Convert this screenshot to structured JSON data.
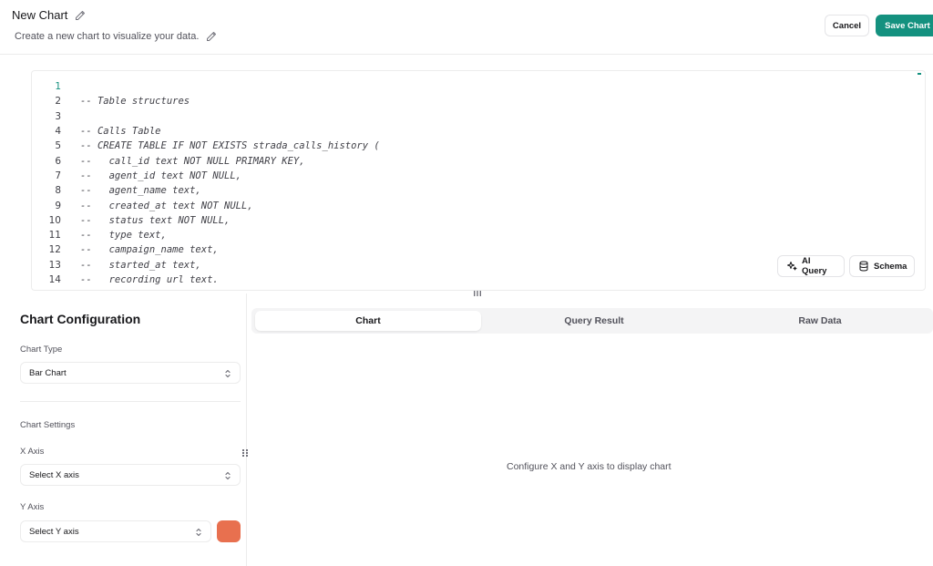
{
  "header": {
    "title": "New Chart",
    "description": "Create a new chart to visualize your data.",
    "cancel_label": "Cancel",
    "save_label": "Save Chart"
  },
  "editor": {
    "active_line": 1,
    "lines": [
      {
        "num": "1",
        "code": ""
      },
      {
        "num": "2",
        "code": "-- Table structures"
      },
      {
        "num": "3",
        "code": ""
      },
      {
        "num": "4",
        "code": "-- Calls Table"
      },
      {
        "num": "5",
        "code": "-- CREATE TABLE IF NOT EXISTS strada_calls_history ("
      },
      {
        "num": "6",
        "code": "--   call_id text NOT NULL PRIMARY KEY,"
      },
      {
        "num": "7",
        "code": "--   agent_id text NOT NULL,"
      },
      {
        "num": "8",
        "code": "--   agent_name text,"
      },
      {
        "num": "9",
        "code": "--   created_at text NOT NULL,"
      },
      {
        "num": "10",
        "code": "--   status text NOT NULL,"
      },
      {
        "num": "11",
        "code": "--   type text,"
      },
      {
        "num": "12",
        "code": "--   campaign_name text,"
      },
      {
        "num": "13",
        "code": "--   started_at text,"
      },
      {
        "num": "14",
        "code": "--   recording url text."
      }
    ],
    "ai_query_label": "AI Query",
    "schema_label": "Schema"
  },
  "config": {
    "title": "Chart Configuration",
    "chart_type_label": "Chart Type",
    "chart_type_value": "Bar Chart",
    "chart_settings_label": "Chart Settings",
    "x_axis_label": "X Axis",
    "x_axis_placeholder": "Select X axis",
    "y_axis_label": "Y Axis",
    "y_axis_placeholder": "Select Y axis",
    "series_color": "#e8704f"
  },
  "tabs": [
    {
      "label": "Chart",
      "active": true
    },
    {
      "label": "Query Result",
      "active": false
    },
    {
      "label": "Raw Data",
      "active": false
    }
  ],
  "preview": {
    "empty_message": "Configure X and Y axis to display chart"
  },
  "icons": {
    "title_edit": "pencil-icon",
    "desc_edit": "pencil-icon",
    "ai_query": "sparkles-icon",
    "schema": "database-icon",
    "select_chevron": "chevrons-up-down-icon",
    "resize_handle": "grip-icon"
  },
  "colors": {
    "accent": "#14917f",
    "swatch": "#e8704f"
  }
}
